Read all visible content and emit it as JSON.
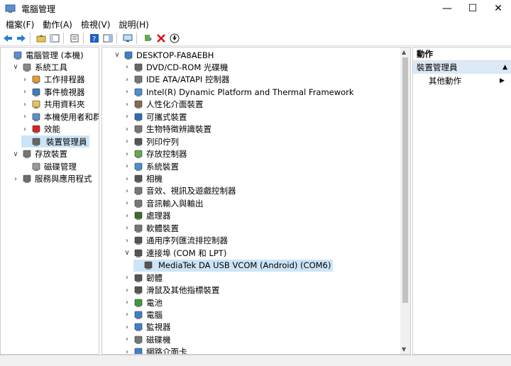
{
  "window": {
    "title": "電腦管理"
  },
  "menu": [
    "檔案(F)",
    "動作(A)",
    "檢視(V)",
    "說明(H)"
  ],
  "left_tree": [
    {
      "label": "電腦管理 (本機)",
      "indent": 0,
      "chev": "",
      "icon": "computer-management-icon"
    },
    {
      "label": "系統工具",
      "indent": 1,
      "chev": "v",
      "icon": "tools-icon"
    },
    {
      "label": "工作排程器",
      "indent": 2,
      "chev": ">",
      "icon": "clock-icon"
    },
    {
      "label": "事件檢視器",
      "indent": 2,
      "chev": ">",
      "icon": "event-viewer-icon"
    },
    {
      "label": "共用資料夾",
      "indent": 2,
      "chev": ">",
      "icon": "folder-icon"
    },
    {
      "label": "本機使用者和群組",
      "indent": 2,
      "chev": ">",
      "icon": "users-icon"
    },
    {
      "label": "效能",
      "indent": 2,
      "chev": ">",
      "icon": "performance-icon"
    },
    {
      "label": "裝置管理員",
      "indent": 2,
      "chev": "",
      "icon": "device-manager-icon",
      "selected": true
    },
    {
      "label": "存放裝置",
      "indent": 1,
      "chev": "v",
      "icon": "storage-icon"
    },
    {
      "label": "磁碟管理",
      "indent": 2,
      "chev": "",
      "icon": "disk-icon"
    },
    {
      "label": "服務與應用程式",
      "indent": 1,
      "chev": ">",
      "icon": "services-icon"
    }
  ],
  "device_tree": [
    {
      "label": "DESKTOP-FA8AEBH",
      "indent": 0,
      "chev": "v",
      "icon": "computer-icon"
    },
    {
      "label": "DVD/CD-ROM 光碟機",
      "indent": 1,
      "chev": ">",
      "icon": "dvd-icon"
    },
    {
      "label": "IDE ATA/ATAPI 控制器",
      "indent": 1,
      "chev": ">",
      "icon": "ide-icon"
    },
    {
      "label": "Intel(R) Dynamic Platform and Thermal Framework",
      "indent": 1,
      "chev": ">",
      "icon": "folder-blue-icon"
    },
    {
      "label": "人性化介面裝置",
      "indent": 1,
      "chev": ">",
      "icon": "hid-icon"
    },
    {
      "label": "可攜式裝置",
      "indent": 1,
      "chev": ">",
      "icon": "portable-icon"
    },
    {
      "label": "生物特徵辨識裝置",
      "indent": 1,
      "chev": ">",
      "icon": "biometric-icon"
    },
    {
      "label": "列印佇列",
      "indent": 1,
      "chev": ">",
      "icon": "printer-icon"
    },
    {
      "label": "存放控制器",
      "indent": 1,
      "chev": ">",
      "icon": "storage-controller-icon"
    },
    {
      "label": "系統裝置",
      "indent": 1,
      "chev": ">",
      "icon": "system-icon"
    },
    {
      "label": "相機",
      "indent": 1,
      "chev": ">",
      "icon": "camera-icon"
    },
    {
      "label": "音效、視訊及遊戲控制器",
      "indent": 1,
      "chev": ">",
      "icon": "sound-icon"
    },
    {
      "label": "音訊輸入與輸出",
      "indent": 1,
      "chev": ">",
      "icon": "audio-icon"
    },
    {
      "label": "處理器",
      "indent": 1,
      "chev": ">",
      "icon": "cpu-icon"
    },
    {
      "label": "軟體裝置",
      "indent": 1,
      "chev": ">",
      "icon": "software-device-icon"
    },
    {
      "label": "通用序列匯流排控制器",
      "indent": 1,
      "chev": ">",
      "icon": "usb-icon"
    },
    {
      "label": "連接埠 (COM 和 LPT)",
      "indent": 1,
      "chev": "v",
      "icon": "port-icon"
    },
    {
      "label": "MediaTek DA USB VCOM (Android) (COM6)",
      "indent": 2,
      "chev": "",
      "icon": "port-device-icon",
      "selected": true
    },
    {
      "label": "韌體",
      "indent": 1,
      "chev": ">",
      "icon": "firmware-icon"
    },
    {
      "label": "滑鼠及其他指標裝置",
      "indent": 1,
      "chev": ">",
      "icon": "mouse-icon"
    },
    {
      "label": "電池",
      "indent": 1,
      "chev": ">",
      "icon": "battery-icon"
    },
    {
      "label": "電腦",
      "indent": 1,
      "chev": ">",
      "icon": "monitor-computer-icon"
    },
    {
      "label": "監視器",
      "indent": 1,
      "chev": ">",
      "icon": "monitor-icon"
    },
    {
      "label": "磁碟機",
      "indent": 1,
      "chev": ">",
      "icon": "disk-drive-icon"
    },
    {
      "label": "網路介面卡",
      "indent": 1,
      "chev": ">",
      "icon": "network-icon"
    }
  ],
  "actions": {
    "header": "動作",
    "section": "裝置管理員",
    "more": "其他動作"
  },
  "colors": {
    "selection": "#cce4f7",
    "actions_selected": "#dbe8f5"
  }
}
